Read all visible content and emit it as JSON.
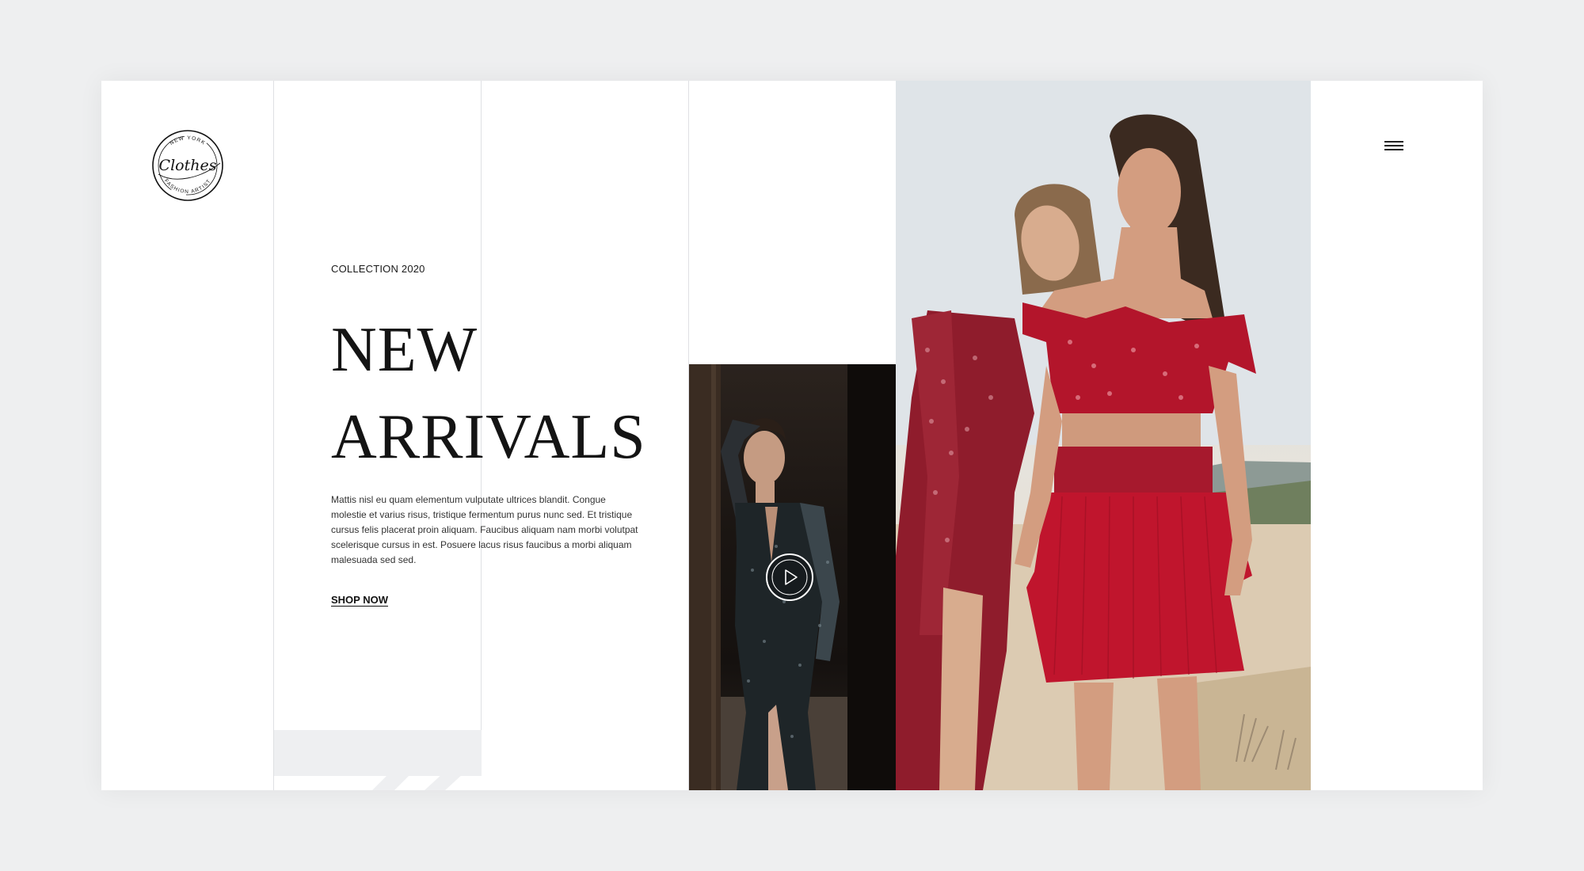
{
  "brand": {
    "logo_top_text": "NEW YORK",
    "logo_script_text": "Clothes",
    "logo_bottom_text": "FASHION ARTIST"
  },
  "hero": {
    "eyebrow": "COLLECTION 2020",
    "headline_line1": "NEW",
    "headline_line2": "ARRIVALS",
    "description": "Mattis nisl eu quam elementum vulputate ultrices blandit. Congue molestie et varius risus, tristique fermentum purus nunc sed. Et tristique cursus felis placerat proin aliquam. Faucibus aliquam nam morbi volutpat scelerisque cursus in est. Posuere lacus risus faucibus a morbi aliquam malesuada sed sed.",
    "cta_label": "SHOP NOW"
  },
  "icons": {
    "menu": "hamburger-menu-icon",
    "play": "play-icon"
  },
  "colors": {
    "background": "#eeeff0",
    "accent_red": "#b3152b",
    "text": "#141414"
  }
}
